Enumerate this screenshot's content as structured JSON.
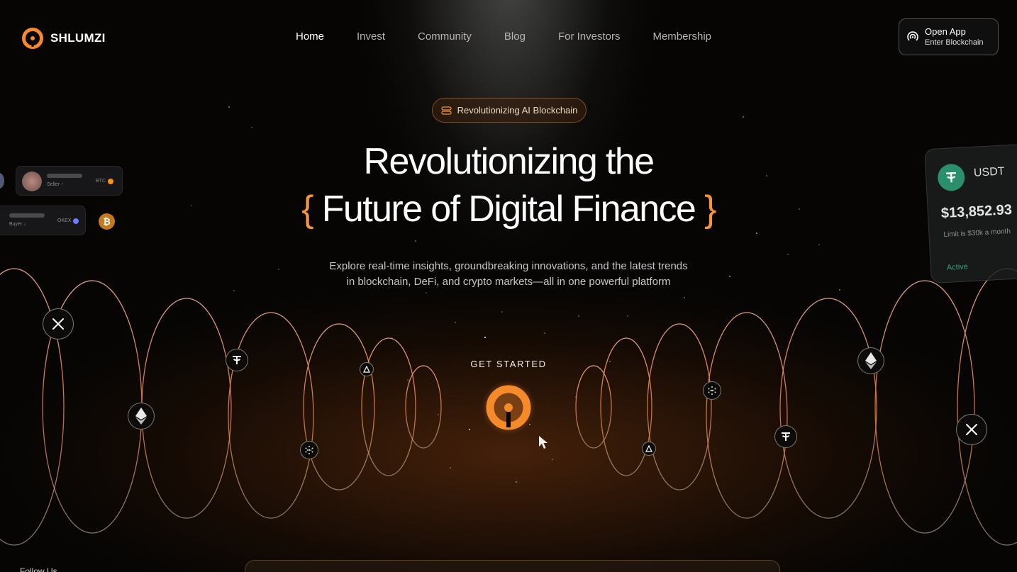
{
  "brand": {
    "name": "SHLUMZI",
    "accent": "#F58A2A"
  },
  "nav": {
    "items": [
      {
        "label": "Home",
        "active": true
      },
      {
        "label": "Invest",
        "active": false
      },
      {
        "label": "Community",
        "active": false
      },
      {
        "label": "Blog",
        "active": false
      },
      {
        "label": "For Investors",
        "active": false
      },
      {
        "label": "Membership",
        "active": false
      }
    ],
    "cta": {
      "title": "Open App",
      "subtitle": "Enter Blockchain",
      "icon": "signal-icon"
    }
  },
  "hero": {
    "badge": "Revolutionizing AI Blockchain",
    "headline_line1": "Revolutionizing the",
    "headline_line2_open": "{",
    "headline_line2": " Future of Digital Finance ",
    "headline_line2_close": "}",
    "subtitle_line1": "Explore real-time insights, groundbreaking innovations, and the latest trends",
    "subtitle_line2": "in blockchain, DeFi, and crypto markets—all in one powerful platform",
    "cta_label": "GET STARTED"
  },
  "left_cards": [
    {
      "role": "Seller ↑",
      "pair": "BTC"
    },
    {
      "role": "Buyer ↓",
      "pair": "OKEX"
    }
  ],
  "usdt_card": {
    "coin": "USDT",
    "amount": "$13,852.93",
    "limit": "Limit is $30k a month",
    "status": "Active",
    "color": "#2A8F6B"
  },
  "tokens": [
    "x-icon",
    "ethereum-icon",
    "tether-icon",
    "cardano-icon",
    "arbitrum-icon"
  ],
  "footer": {
    "follow": "Follow Us"
  }
}
